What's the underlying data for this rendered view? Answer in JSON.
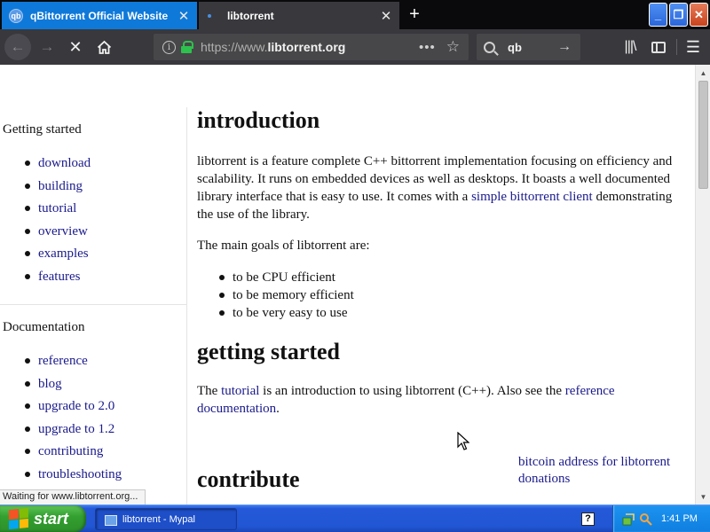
{
  "tabs": [
    {
      "title": "qBittorrent Official Website",
      "favicon": "qb",
      "active": true
    },
    {
      "title": "libtorrent",
      "active": false
    }
  ],
  "window_controls": {
    "minimize": "_",
    "maximize": "❐",
    "close": "✕"
  },
  "navbar": {
    "url_prefix": "https://www.",
    "url_domain": "libtorrent.org",
    "search_query": "qb"
  },
  "sidebar": {
    "sections": [
      {
        "heading": "Getting started",
        "links": [
          "download",
          "building",
          "tutorial",
          "overview",
          "examples",
          "features"
        ]
      },
      {
        "heading": "Documentation",
        "links": [
          "reference",
          "blog",
          "upgrade to 2.0",
          "upgrade to 1.2",
          "contributing",
          "troubleshooting"
        ]
      }
    ]
  },
  "content": {
    "intro_heading": "introduction",
    "intro_text_before_link": "libtorrent is a feature complete C++ bittorrent implementation focusing on efficiency and scalability. It runs on embedded devices as well as desktops. It boasts a well documented library interface that is easy to use. It comes with a ",
    "intro_link": "simple bittorrent client",
    "intro_text_after_link": " demonstrating the use of the library.",
    "goals_intro": "The main goals of libtorrent are:",
    "goals": [
      "to be CPU efficient",
      "to be memory efficient",
      "to be very easy to use"
    ],
    "getting_started_heading": "getting started",
    "gs_text_1": "The ",
    "gs_link_1": "tutorial",
    "gs_text_2": " is an introduction to using libtorrent (C++). Also see the ",
    "gs_link_2": "reference documentation",
    "gs_text_3": ".",
    "contribute_heading": "contribute",
    "donation_link": "bitcoin address for libtorrent donations"
  },
  "status_text": "Waiting for www.libtorrent.org...",
  "taskbar": {
    "start_label": "start",
    "window_button": "libtorrent - Mypal",
    "help_glyph": "?",
    "clock": "1:41 PM"
  },
  "colors": {
    "active_tab": "#0f79d9",
    "link": "#1a1a8c",
    "taskbar": "#2156d3",
    "start_button": "#34a131",
    "tray": "#0f7fe0"
  }
}
